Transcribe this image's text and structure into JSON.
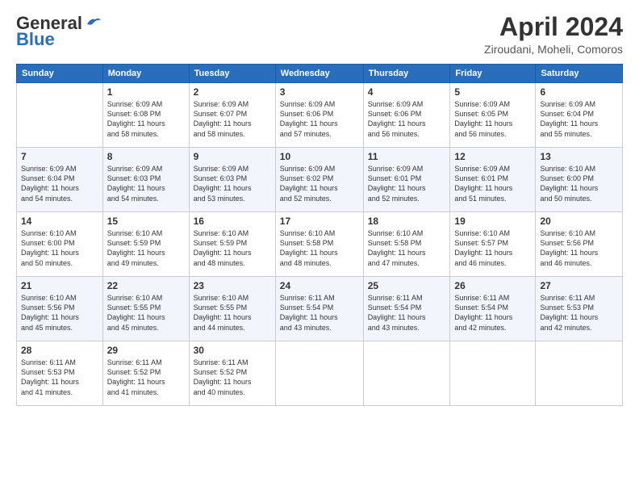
{
  "header": {
    "logo_general": "General",
    "logo_blue": "Blue",
    "title": "April 2024",
    "location": "Ziroudani, Moheli, Comoros"
  },
  "columns": [
    "Sunday",
    "Monday",
    "Tuesday",
    "Wednesday",
    "Thursday",
    "Friday",
    "Saturday"
  ],
  "weeks": [
    [
      {
        "day": "",
        "info": ""
      },
      {
        "day": "1",
        "info": "Sunrise: 6:09 AM\nSunset: 6:08 PM\nDaylight: 11 hours\nand 58 minutes."
      },
      {
        "day": "2",
        "info": "Sunrise: 6:09 AM\nSunset: 6:07 PM\nDaylight: 11 hours\nand 58 minutes."
      },
      {
        "day": "3",
        "info": "Sunrise: 6:09 AM\nSunset: 6:06 PM\nDaylight: 11 hours\nand 57 minutes."
      },
      {
        "day": "4",
        "info": "Sunrise: 6:09 AM\nSunset: 6:06 PM\nDaylight: 11 hours\nand 56 minutes."
      },
      {
        "day": "5",
        "info": "Sunrise: 6:09 AM\nSunset: 6:05 PM\nDaylight: 11 hours\nand 56 minutes."
      },
      {
        "day": "6",
        "info": "Sunrise: 6:09 AM\nSunset: 6:04 PM\nDaylight: 11 hours\nand 55 minutes."
      }
    ],
    [
      {
        "day": "7",
        "info": "Sunrise: 6:09 AM\nSunset: 6:04 PM\nDaylight: 11 hours\nand 54 minutes."
      },
      {
        "day": "8",
        "info": "Sunrise: 6:09 AM\nSunset: 6:03 PM\nDaylight: 11 hours\nand 54 minutes."
      },
      {
        "day": "9",
        "info": "Sunrise: 6:09 AM\nSunset: 6:03 PM\nDaylight: 11 hours\nand 53 minutes."
      },
      {
        "day": "10",
        "info": "Sunrise: 6:09 AM\nSunset: 6:02 PM\nDaylight: 11 hours\nand 52 minutes."
      },
      {
        "day": "11",
        "info": "Sunrise: 6:09 AM\nSunset: 6:01 PM\nDaylight: 11 hours\nand 52 minutes."
      },
      {
        "day": "12",
        "info": "Sunrise: 6:09 AM\nSunset: 6:01 PM\nDaylight: 11 hours\nand 51 minutes."
      },
      {
        "day": "13",
        "info": "Sunrise: 6:10 AM\nSunset: 6:00 PM\nDaylight: 11 hours\nand 50 minutes."
      }
    ],
    [
      {
        "day": "14",
        "info": "Sunrise: 6:10 AM\nSunset: 6:00 PM\nDaylight: 11 hours\nand 50 minutes."
      },
      {
        "day": "15",
        "info": "Sunrise: 6:10 AM\nSunset: 5:59 PM\nDaylight: 11 hours\nand 49 minutes."
      },
      {
        "day": "16",
        "info": "Sunrise: 6:10 AM\nSunset: 5:59 PM\nDaylight: 11 hours\nand 48 minutes."
      },
      {
        "day": "17",
        "info": "Sunrise: 6:10 AM\nSunset: 5:58 PM\nDaylight: 11 hours\nand 48 minutes."
      },
      {
        "day": "18",
        "info": "Sunrise: 6:10 AM\nSunset: 5:58 PM\nDaylight: 11 hours\nand 47 minutes."
      },
      {
        "day": "19",
        "info": "Sunrise: 6:10 AM\nSunset: 5:57 PM\nDaylight: 11 hours\nand 46 minutes."
      },
      {
        "day": "20",
        "info": "Sunrise: 6:10 AM\nSunset: 5:56 PM\nDaylight: 11 hours\nand 46 minutes."
      }
    ],
    [
      {
        "day": "21",
        "info": "Sunrise: 6:10 AM\nSunset: 5:56 PM\nDaylight: 11 hours\nand 45 minutes."
      },
      {
        "day": "22",
        "info": "Sunrise: 6:10 AM\nSunset: 5:55 PM\nDaylight: 11 hours\nand 45 minutes."
      },
      {
        "day": "23",
        "info": "Sunrise: 6:10 AM\nSunset: 5:55 PM\nDaylight: 11 hours\nand 44 minutes."
      },
      {
        "day": "24",
        "info": "Sunrise: 6:11 AM\nSunset: 5:54 PM\nDaylight: 11 hours\nand 43 minutes."
      },
      {
        "day": "25",
        "info": "Sunrise: 6:11 AM\nSunset: 5:54 PM\nDaylight: 11 hours\nand 43 minutes."
      },
      {
        "day": "26",
        "info": "Sunrise: 6:11 AM\nSunset: 5:54 PM\nDaylight: 11 hours\nand 42 minutes."
      },
      {
        "day": "27",
        "info": "Sunrise: 6:11 AM\nSunset: 5:53 PM\nDaylight: 11 hours\nand 42 minutes."
      }
    ],
    [
      {
        "day": "28",
        "info": "Sunrise: 6:11 AM\nSunset: 5:53 PM\nDaylight: 11 hours\nand 41 minutes."
      },
      {
        "day": "29",
        "info": "Sunrise: 6:11 AM\nSunset: 5:52 PM\nDaylight: 11 hours\nand 41 minutes."
      },
      {
        "day": "30",
        "info": "Sunrise: 6:11 AM\nSunset: 5:52 PM\nDaylight: 11 hours\nand 40 minutes."
      },
      {
        "day": "",
        "info": ""
      },
      {
        "day": "",
        "info": ""
      },
      {
        "day": "",
        "info": ""
      },
      {
        "day": "",
        "info": ""
      }
    ]
  ]
}
